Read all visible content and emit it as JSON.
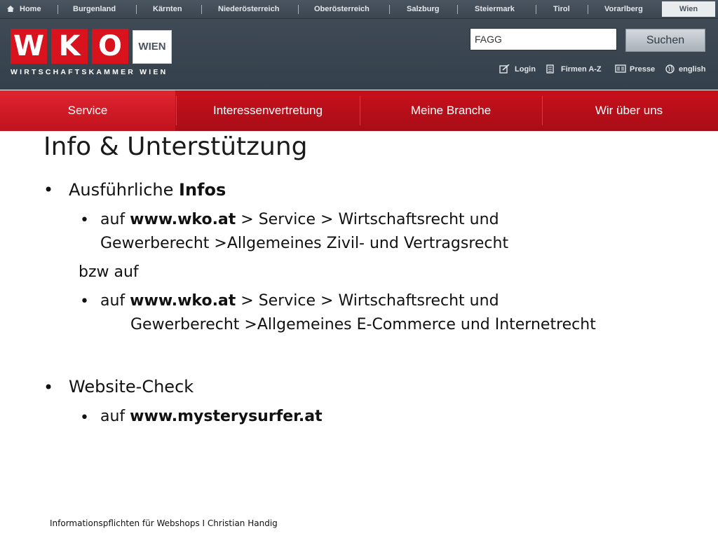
{
  "regions": {
    "home": "Home",
    "items": [
      "Burgenland",
      "Kärnten",
      "Niederösterreich",
      "Oberösterreich",
      "Salzburg",
      "Steiermark",
      "Tirol",
      "Vorarlberg"
    ],
    "active": "Wien"
  },
  "logo": {
    "letters": [
      "W",
      "K",
      "O"
    ],
    "wien": "WIEN",
    "tagline": "WIRTSCHAFTSKAMMER WIEN",
    "brand_color": "#d8131e"
  },
  "search": {
    "value": "FAGG",
    "button": "Suchen"
  },
  "utilities": {
    "login": "Login",
    "firmen": "Firmen A-Z",
    "presse": "Presse",
    "english": "english"
  },
  "mainnav": {
    "tabs": [
      "Service",
      "Interessenvertretung",
      "Meine Branche",
      "Wir über uns"
    ],
    "active": "Service"
  },
  "content": {
    "title": "Info & Unterstützung",
    "bullet_char": "•",
    "b1_text": "Ausführliche ",
    "b1_bold": "Infos",
    "s1_pre": "auf ",
    "s1_link": "www.wko.at",
    "s1_rest": " > Service > Wirtschaftsrecht und",
    "s1_line2": "Gewerberecht >Allgemeines Zivil- und Vertragsrecht",
    "bzw": "bzw auf",
    "s2_pre": "auf ",
    "s2_link": "www.wko.at",
    "s2_rest": " > Service > Wirtschaftsrecht und",
    "s2_line2": "Gewerberecht >Allgemeines E-Commerce und Internetrecht",
    "b2_text": "Website-Check",
    "s3_pre": "auf ",
    "s3_link": "www.mysterysurfer.at"
  },
  "footer": "Informationspflichten für Webshops I  Christian Handig"
}
